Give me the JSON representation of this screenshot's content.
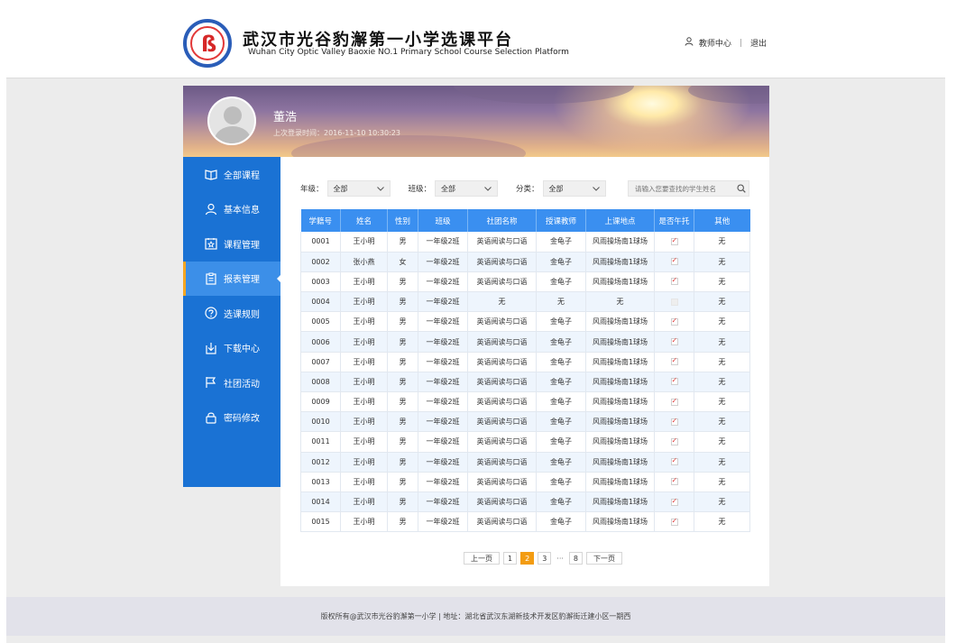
{
  "header": {
    "title_cn": "武汉市光谷豹澥第一小学选课平台",
    "title_en": "Wuhan City Optic Valley Baoxie NO.1 Primary School Course Selection Platform",
    "teacher_center": "教师中心",
    "separator": "|",
    "logout": "退出"
  },
  "banner": {
    "user_name": "董浩",
    "last_login": "上次登录时间：2016-11-10  10:30:23"
  },
  "sidebar": {
    "items": [
      {
        "label": "全部课程",
        "icon": "book-icon"
      },
      {
        "label": "基本信息",
        "icon": "user-icon"
      },
      {
        "label": "课程管理",
        "icon": "star-calendar-icon"
      },
      {
        "label": "报表管理",
        "icon": "clipboard-icon"
      },
      {
        "label": "选课规则",
        "icon": "question-icon"
      },
      {
        "label": "下载中心",
        "icon": "download-icon"
      },
      {
        "label": "社团活动",
        "icon": "flag-icon"
      },
      {
        "label": "密码修改",
        "icon": "lock-icon"
      }
    ],
    "active_index": 3
  },
  "filters": {
    "grade_label": "年级：",
    "grade_value": "全部",
    "class_label": "班级：",
    "class_value": "全部",
    "category_label": "分类：",
    "category_value": "全部",
    "search_placeholder": "请输入您要查找的学生姓名"
  },
  "table": {
    "headers": [
      "学籍号",
      "姓名",
      "性别",
      "班级",
      "社团名称",
      "授课教师",
      "上课地点",
      "是否午托",
      "其他"
    ],
    "rows": [
      {
        "id": "0001",
        "name": "王小明",
        "gender": "男",
        "class": "一年级2班",
        "club": "英语阅读与口语",
        "teacher": "金龟子",
        "place": "风雨操场南1球场",
        "lunch": true,
        "other": "无"
      },
      {
        "id": "0002",
        "name": "张小燕",
        "gender": "女",
        "class": "一年级2班",
        "club": "英语阅读与口语",
        "teacher": "金龟子",
        "place": "风雨操场南1球场",
        "lunch": true,
        "other": "无"
      },
      {
        "id": "0003",
        "name": "王小明",
        "gender": "男",
        "class": "一年级2班",
        "club": "英语阅读与口语",
        "teacher": "金龟子",
        "place": "风雨操场南1球场",
        "lunch": true,
        "other": "无"
      },
      {
        "id": "0004",
        "name": "王小明",
        "gender": "男",
        "class": "一年级2班",
        "club": "无",
        "teacher": "无",
        "place": "无",
        "lunch": false,
        "other": "无"
      },
      {
        "id": "0005",
        "name": "王小明",
        "gender": "男",
        "class": "一年级2班",
        "club": "英语阅读与口语",
        "teacher": "金龟子",
        "place": "风雨操场南1球场",
        "lunch": true,
        "other": "无"
      },
      {
        "id": "0006",
        "name": "王小明",
        "gender": "男",
        "class": "一年级2班",
        "club": "英语阅读与口语",
        "teacher": "金龟子",
        "place": "风雨操场南1球场",
        "lunch": true,
        "other": "无"
      },
      {
        "id": "0007",
        "name": "王小明",
        "gender": "男",
        "class": "一年级2班",
        "club": "英语阅读与口语",
        "teacher": "金龟子",
        "place": "风雨操场南1球场",
        "lunch": true,
        "other": "无"
      },
      {
        "id": "0008",
        "name": "王小明",
        "gender": "男",
        "class": "一年级2班",
        "club": "英语阅读与口语",
        "teacher": "金龟子",
        "place": "风雨操场南1球场",
        "lunch": true,
        "other": "无"
      },
      {
        "id": "0009",
        "name": "王小明",
        "gender": "男",
        "class": "一年级2班",
        "club": "英语阅读与口语",
        "teacher": "金龟子",
        "place": "风雨操场南1球场",
        "lunch": true,
        "other": "无"
      },
      {
        "id": "0010",
        "name": "王小明",
        "gender": "男",
        "class": "一年级2班",
        "club": "英语阅读与口语",
        "teacher": "金龟子",
        "place": "风雨操场南1球场",
        "lunch": true,
        "other": "无"
      },
      {
        "id": "0011",
        "name": "王小明",
        "gender": "男",
        "class": "一年级2班",
        "club": "英语阅读与口语",
        "teacher": "金龟子",
        "place": "风雨操场南1球场",
        "lunch": true,
        "other": "无"
      },
      {
        "id": "0012",
        "name": "王小明",
        "gender": "男",
        "class": "一年级2班",
        "club": "英语阅读与口语",
        "teacher": "金龟子",
        "place": "风雨操场南1球场",
        "lunch": true,
        "other": "无"
      },
      {
        "id": "0013",
        "name": "王小明",
        "gender": "男",
        "class": "一年级2班",
        "club": "英语阅读与口语",
        "teacher": "金龟子",
        "place": "风雨操场南1球场",
        "lunch": true,
        "other": "无"
      },
      {
        "id": "0014",
        "name": "王小明",
        "gender": "男",
        "class": "一年级2班",
        "club": "英语阅读与口语",
        "teacher": "金龟子",
        "place": "风雨操场南1球场",
        "lunch": true,
        "other": "无"
      },
      {
        "id": "0015",
        "name": "王小明",
        "gender": "男",
        "class": "一年级2班",
        "club": "英语阅读与口语",
        "teacher": "金龟子",
        "place": "风雨操场南1球场",
        "lunch": true,
        "other": "无"
      }
    ]
  },
  "pagination": {
    "prev": "上一页",
    "pages": [
      "1",
      "2",
      "3"
    ],
    "current": "2",
    "ellipsis": "···",
    "last": "8",
    "next": "下一页"
  },
  "footer": {
    "text": "版权所有@武汉市光谷豹澥第一小学 | 地址：湖北省武汉东湖新技术开发区豹澥街迁建小区一期西"
  },
  "colors": {
    "primary": "#1a72d4",
    "table_header": "#3a8ff0",
    "active_marker": "#f5a623",
    "current_page": "#f39c12",
    "check": "#e03c3c"
  }
}
